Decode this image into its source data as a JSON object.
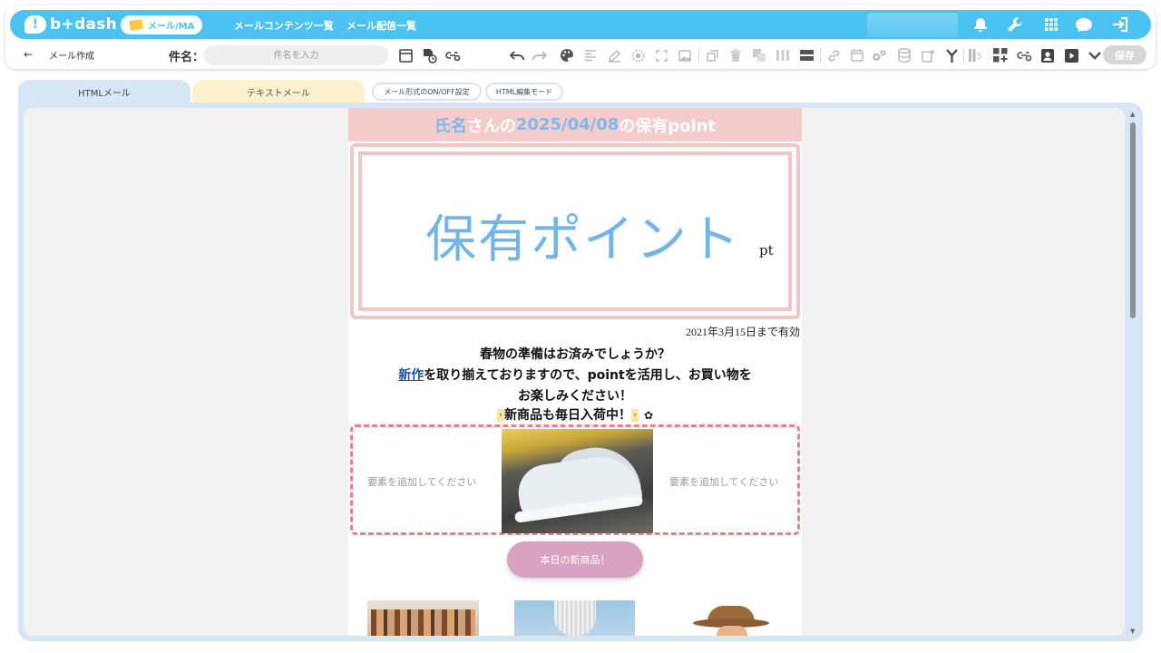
{
  "app": {
    "logo_text": "b+dash",
    "mode_label": "メール/MA",
    "nav": [
      "メールコンテンツ一覧",
      "メール配信一覧"
    ]
  },
  "toolbar": {
    "back_label": "←",
    "page_title": "メール作成",
    "subject_label": "件名：",
    "subject_placeholder": "件名を入力",
    "save_label": "保存"
  },
  "tabs": {
    "html": "HTMLメール",
    "text": "テキストメール",
    "format_toggle": "メール形式のON/OFF設定",
    "html_edit": "HTML編集モード"
  },
  "mail": {
    "header": {
      "name": "氏名",
      "mid1": "さんの",
      "date": "2025/04/08",
      "mid2": "の保有point"
    },
    "point_title": "保有ポイント",
    "point_unit": "pt",
    "valid_until": "2021年3月15日まで有効",
    "line1": "春物の準備はお済みでしょうか？",
    "line2_link": "新作",
    "line2_rest": "を取り揃えておりますので、pointを活用し、お買い物を",
    "line3": "お楽しみください！",
    "new_arrivals": "新商品も毎日入荷中！",
    "add_element_left": "要素を追加してください",
    "add_element_right": "要素を追加してください",
    "cta": "本日の新商品！"
  },
  "colors": {
    "brand": "#4cc2f2",
    "header_pink": "#f5cccc",
    "point_blue": "#74b5e8",
    "dashed_border": "#ef7f86",
    "cta_pink": "#d8a3c0"
  }
}
